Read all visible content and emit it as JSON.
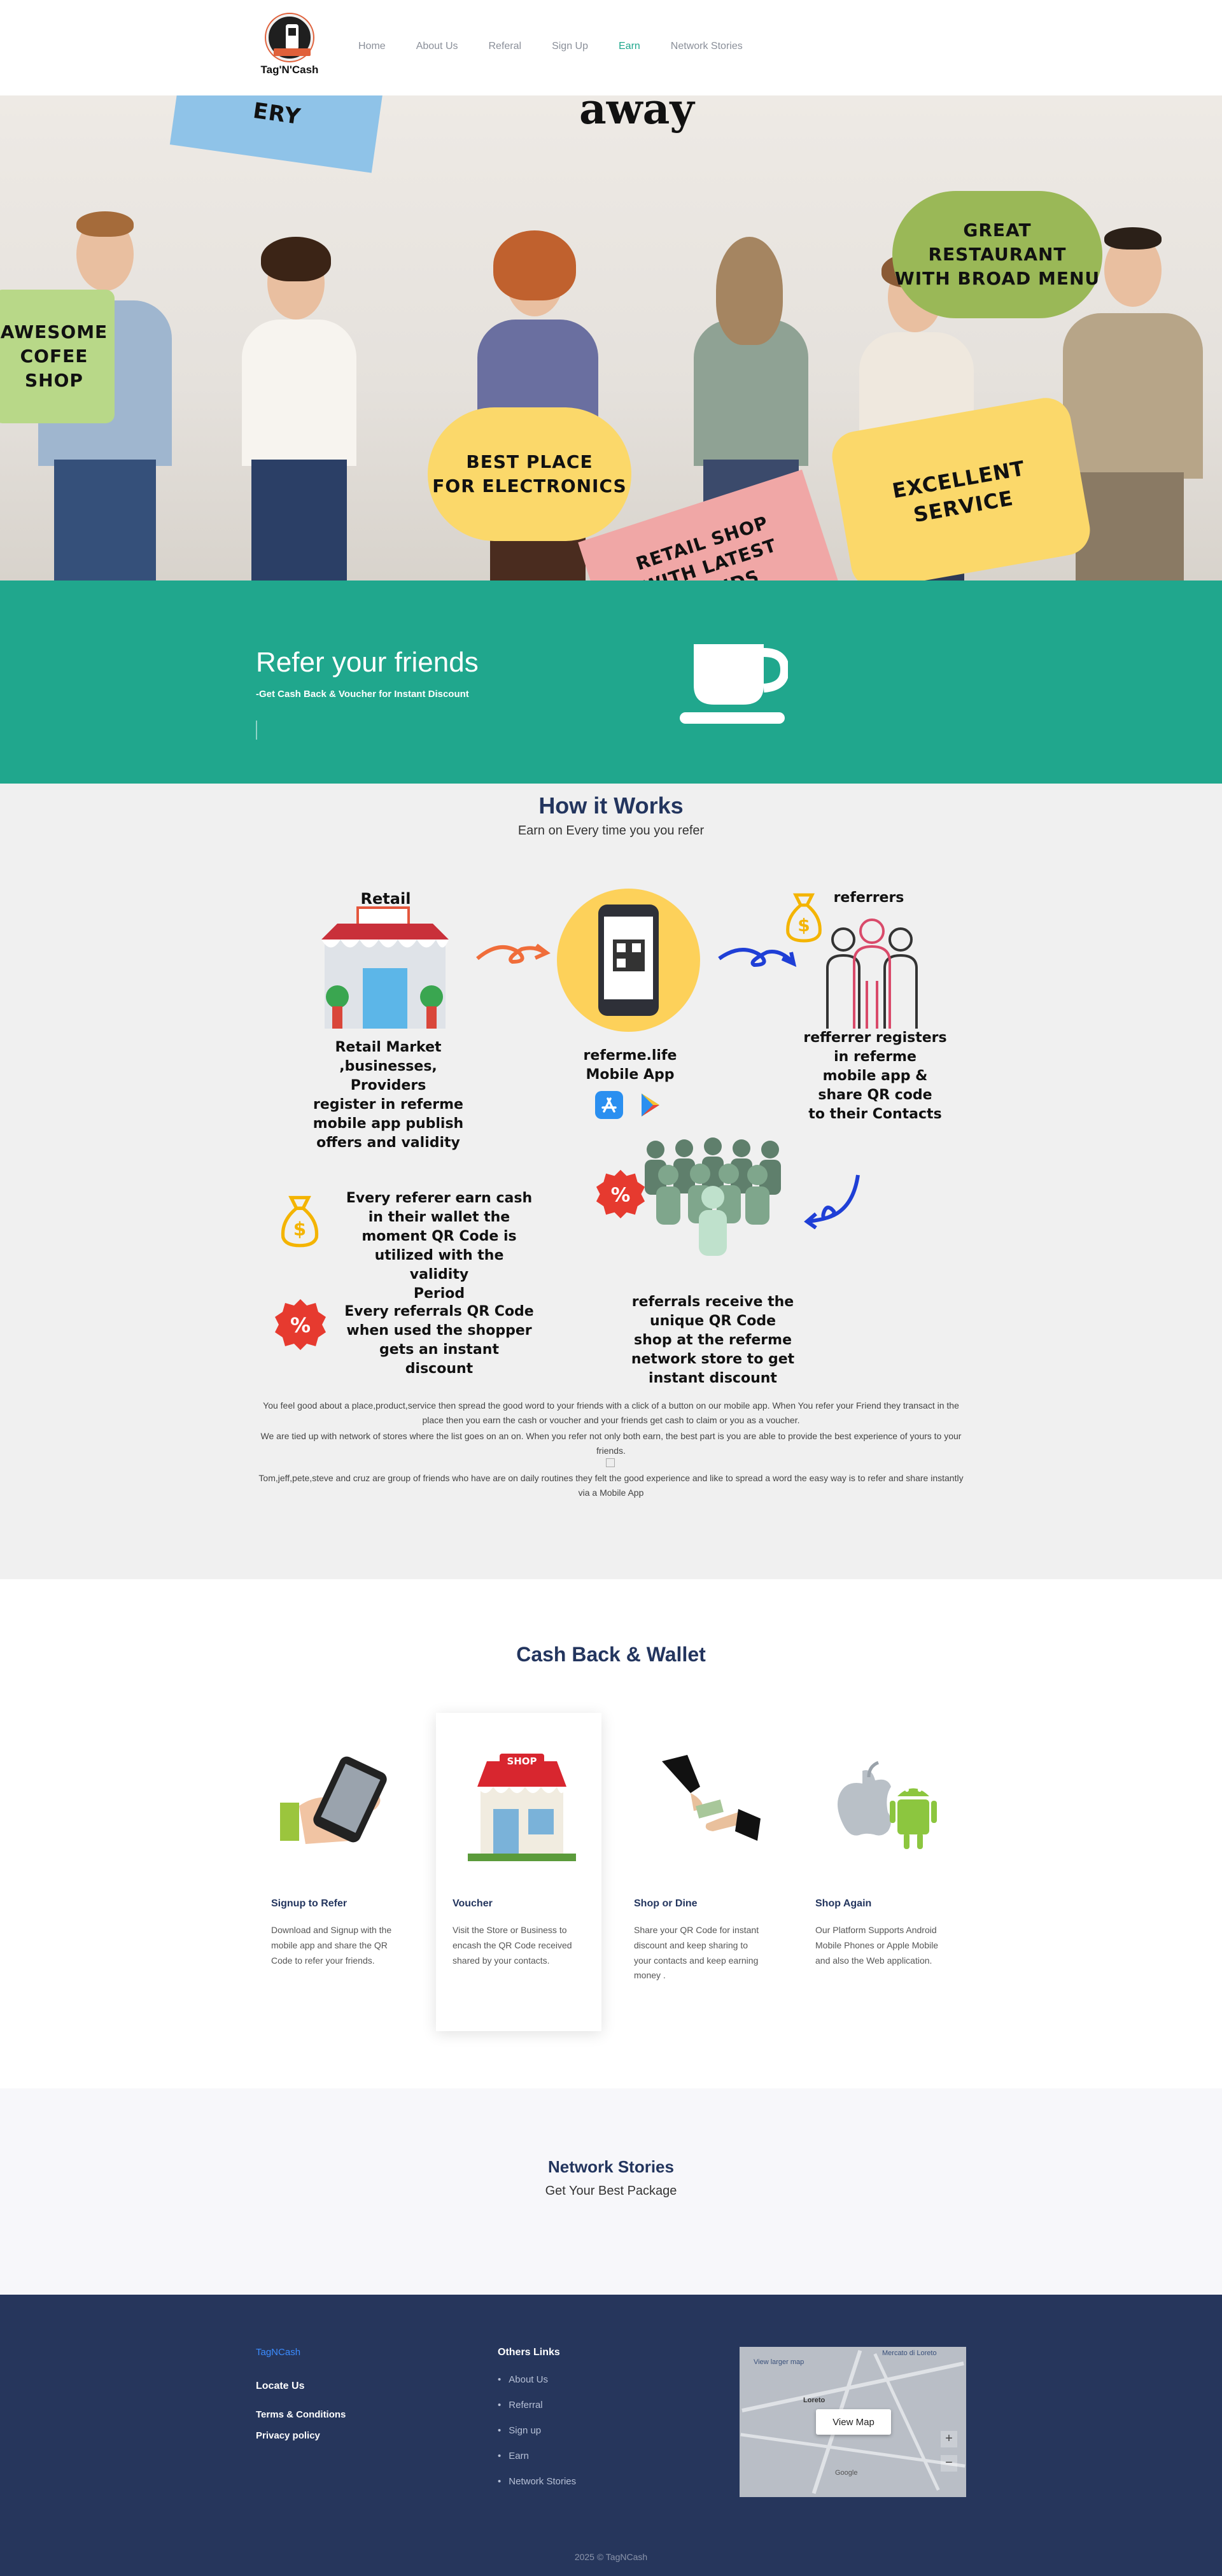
{
  "nav": {
    "logo_text": "Tag'N'Cash",
    "items": [
      {
        "label": "Home"
      },
      {
        "label": "About Us"
      },
      {
        "label": "Referal"
      },
      {
        "label": "Sign Up"
      },
      {
        "label": "Earn",
        "active": true
      },
      {
        "label": "Network Stories"
      }
    ]
  },
  "hero": {
    "top_text": "away",
    "signs": {
      "top_left": "ERY",
      "coffee": "AWESOME\nCOFEE\nSHOP",
      "electronics": "BEST PLACE\nFOR ELECTRONICS",
      "retail": "RETAIL SHOP\nWITH LATEST\nBRANDS",
      "restaurant": "GREAT\nRESTAURANT\nWITH BROAD MENU",
      "service": "EXCELLENT\nSERVICE"
    }
  },
  "refer": {
    "title": "Refer your friends",
    "subtitle": "-Get Cash Back & Voucher for Instant Discount",
    "icon": "coffee-cup-icon"
  },
  "how": {
    "title": "How it Works",
    "subtitle": "Earn on Every time you you refer",
    "retail_label": "Retail",
    "retail_text": "Retail Market ,businesses,\nProviders\nregister in referme\nmobile app publish\noffers and validity",
    "app_text": "referme.life\nMobile App",
    "referrers_label": "referrers",
    "referrers_text": "refferrer registers\nin referme\nmobile app &\nshare QR code\nto their Contacts",
    "earn_text": "Every referer earn cash\nin their wallet the\nmoment QR Code is\nutilized with the validity\nPeriod",
    "discount_text": "Every referrals QR Code\nwhen used the shopper\ngets an instant discount",
    "referrals_text": "referrals receive the\nunique QR Code\nshop at the referme\nnetwork store to get\ninstant discount",
    "para1": "You feel good about a place,product,service then spread the good word to your friends with a click of a button on our mobile app. When You refer your Friend they transact in the place then you earn the cash or voucher and your friends get cash to claim or you as a voucher.",
    "para2": "We are tied up with network of stores where the list goes on an on. When you refer not only both earn, the best part is you are able to provide the best experience of yours to your friends.",
    "para3": "Tom,jeff,pete,steve and cruz are group of friends who have are on daily routines they felt the good experience and like to spread a word the easy way is to refer and share instantly via a Mobile App"
  },
  "cashback": {
    "title": "Cash Back & Wallet",
    "cards": [
      {
        "title": "Signup to Refer",
        "desc": "Download and Signup with the mobile app and share the QR Code to refer your friends."
      },
      {
        "title": "Voucher",
        "desc": "Visit the Store or Business to encash the QR Code received shared by your contacts."
      },
      {
        "title": "Shop or Dine",
        "desc": "Share your QR Code for instant discount and keep sharing to your contacts and keep earning money ."
      },
      {
        "title": "Shop Again",
        "desc": "Our Platform Supports Android Mobile Phones or Apple Mobile and also the Web application."
      }
    ],
    "shop_sign": "SHOP"
  },
  "network": {
    "title": "Network Stories",
    "subtitle": "Get Your Best Package"
  },
  "footer": {
    "brand": "TagNCash",
    "locate": "Locate Us",
    "terms": "Terms & Conditions",
    "privacy": "Privacy policy",
    "others_title": "Others Links",
    "links": [
      "About Us",
      "Referral",
      "Sign up",
      "Earn",
      "Network Stories"
    ],
    "map_button": "View Map",
    "map_labels": {
      "view_larger": "View larger map",
      "loreto": "Loreto",
      "google": "Google",
      "mercato": "Mercato di Loreto"
    },
    "copyright": "2025 © TagNCash"
  },
  "colors": {
    "green": "#20a78d",
    "navy": "#26365c",
    "title": "#23355e"
  }
}
